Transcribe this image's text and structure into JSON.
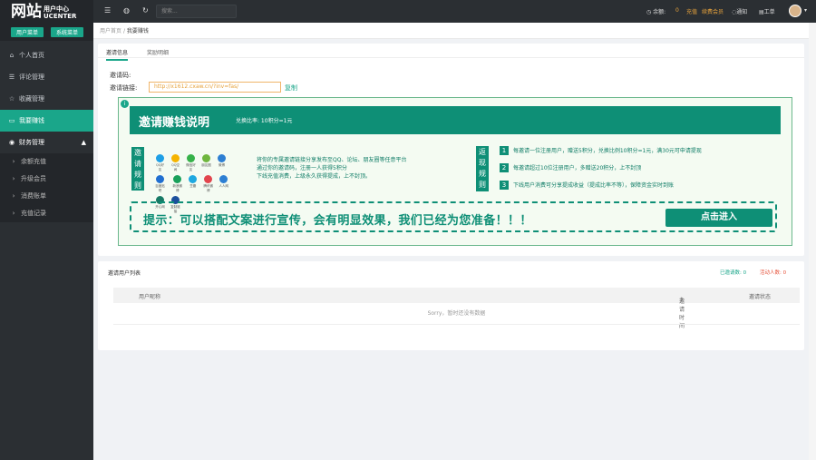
{
  "logo": {
    "big": "网站",
    "small_line1": "用户中心",
    "small_line2": "UCENTER",
    "btn1": "用户菜单",
    "btn2": "系统菜单"
  },
  "nav": [
    {
      "icon": "⌂",
      "label": "个人首页"
    },
    {
      "icon": "☰",
      "label": "评论管理"
    },
    {
      "icon": "☆",
      "label": "收藏管理"
    },
    {
      "icon": "▭",
      "label": "我要赚钱"
    },
    {
      "icon": "◉",
      "label": "财务管理",
      "arrow": "▲"
    }
  ],
  "subnav": [
    "余额充值",
    "升级会员",
    "消费账单",
    "充值记录"
  ],
  "topbar": {
    "menu_icon": "☰",
    "sync_icon": "◍",
    "refresh_icon": "↻",
    "search_placeholder": "搜索...",
    "balance_label": "余额:",
    "balance_value": "0",
    "recharge": "充值",
    "vip": "续费会员",
    "notice": "通知",
    "ticket": "工单",
    "caret": "▾"
  },
  "breadcrumb": {
    "home": "用户首页",
    "sep": "/",
    "current": "我要赚钱"
  },
  "tabs": [
    "邀请信息",
    "奖励明细"
  ],
  "invite": {
    "code_label": "邀请码:",
    "link_label": "邀请链接:",
    "link_value": "http://x1612.cxaw.cn/?inv=fas/",
    "copy": "复制"
  },
  "banner": {
    "title": "邀请赚钱说明",
    "ratio": "兑换比率: 10积分=1元",
    "left_v": "邀请规则",
    "right_v": "返现规则",
    "apps": [
      "QQ好友",
      "QQ空间",
      "微信好友",
      "朋友圈",
      "微博",
      "百度贴吧",
      "新浪微博",
      "豆瓣",
      "腾讯微博",
      "人人网",
      "开心网",
      "复制链接"
    ],
    "desc": [
      "将你的专属邀请链接分享发布至QQ、论坛、朋友圈等任意平台",
      "通过你的邀请码，注册一人获得5积分",
      "下线充值消费，上级永久获得提成，上不封顶。"
    ],
    "rules": [
      {
        "n": "1",
        "text": "每邀请一位注册用户，赠送5积分，兑换比例10积分=1元，满30元可申请提现"
      },
      {
        "n": "2",
        "text": "每邀请超过10位注册用户，多赠送20积分，上不封顶"
      },
      {
        "n": "3",
        "text": "下线用户消费可分享提成收益（提成比率不等），保障资金实时到账"
      }
    ],
    "tip": "提示：可以搭配文案进行宣传，会有明显效果，我们已经为您准备！！！",
    "go": "点击进入",
    "info_icon": "i"
  },
  "list": {
    "title": "邀请用户列表",
    "stat1": "已邀请数: 0",
    "stat2": "活动人数: 0",
    "cols": [
      "用户昵称",
      "邀请时间",
      "邀请状态"
    ],
    "sort": "⇕",
    "empty": "Sorry，暂时还没有数据"
  }
}
